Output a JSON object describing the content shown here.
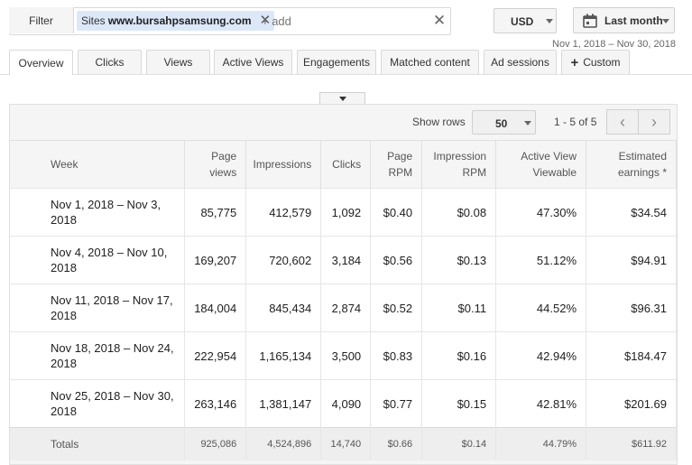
{
  "filter": {
    "label": "Filter",
    "chip_prefix": "Sites",
    "chip_value": "www.bursahpsamsung.com",
    "add_placeholder": "+ add"
  },
  "currency": {
    "value": "USD"
  },
  "date": {
    "label": "Last month",
    "range": "Nov 1, 2018 – Nov 30, 2018"
  },
  "tabs": [
    {
      "label": "Overview"
    },
    {
      "label": "Clicks"
    },
    {
      "label": "Views"
    },
    {
      "label": "Active Views"
    },
    {
      "label": "Engagements"
    },
    {
      "label": "Matched content"
    },
    {
      "label": "Ad sessions"
    },
    {
      "label": "Custom"
    }
  ],
  "table_controls": {
    "show_rows_label": "Show rows",
    "rows_value": "50",
    "paging": "1 - 5 of 5"
  },
  "columns": [
    {
      "line1": "Week",
      "line2": ""
    },
    {
      "line1": "Page",
      "line2": "views"
    },
    {
      "line1": "Impressions",
      "line2": ""
    },
    {
      "line1": "Clicks",
      "line2": ""
    },
    {
      "line1": "Page",
      "line2": "RPM"
    },
    {
      "line1": "Impression",
      "line2": "RPM"
    },
    {
      "line1": "Active View",
      "line2": "Viewable"
    },
    {
      "line1": "Estimated",
      "line2": "earnings *"
    }
  ],
  "rows": [
    {
      "week": "Nov 1, 2018 – Nov 3, 2018",
      "page_views": "85,775",
      "impressions": "412,579",
      "clicks": "1,092",
      "page_rpm": "$0.40",
      "imp_rpm": "$0.08",
      "active_view": "47.30%",
      "earnings": "$34.54"
    },
    {
      "week": "Nov 4, 2018 – Nov 10, 2018",
      "page_views": "169,207",
      "impressions": "720,602",
      "clicks": "3,184",
      "page_rpm": "$0.56",
      "imp_rpm": "$0.13",
      "active_view": "51.12%",
      "earnings": "$94.91"
    },
    {
      "week": "Nov 11, 2018 – Nov 17, 2018",
      "page_views": "184,004",
      "impressions": "845,434",
      "clicks": "2,874",
      "page_rpm": "$0.52",
      "imp_rpm": "$0.11",
      "active_view": "44.52%",
      "earnings": "$96.31"
    },
    {
      "week": "Nov 18, 2018 – Nov 24, 2018",
      "page_views": "222,954",
      "impressions": "1,165,134",
      "clicks": "3,500",
      "page_rpm": "$0.83",
      "imp_rpm": "$0.16",
      "active_view": "42.94%",
      "earnings": "$184.47"
    },
    {
      "week": "Nov 25, 2018 – Nov 30, 2018",
      "page_views": "263,146",
      "impressions": "1,381,147",
      "clicks": "4,090",
      "page_rpm": "$0.77",
      "imp_rpm": "$0.15",
      "active_view": "42.81%",
      "earnings": "$201.69"
    }
  ],
  "totals": {
    "label": "Totals",
    "page_views": "925,086",
    "impressions": "4,524,896",
    "clicks": "14,740",
    "page_rpm": "$0.66",
    "imp_rpm": "$0.14",
    "active_view": "44.79%",
    "earnings": "$611.92"
  }
}
